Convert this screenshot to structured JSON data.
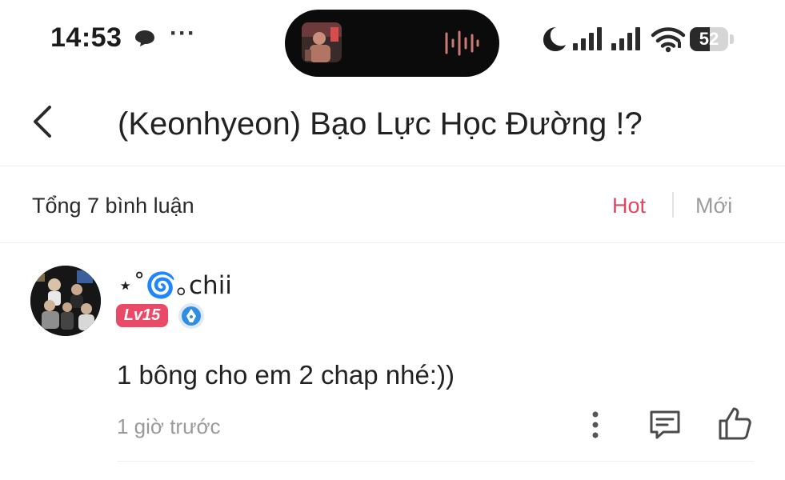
{
  "status_bar": {
    "time": "14:53",
    "battery": "52",
    "battery_level": 0.52,
    "icons": [
      "chat-bubble-icon",
      "more-dots-icon",
      "moon-icon",
      "signal-icon",
      "signal-icon",
      "wifi-icon",
      "battery-icon"
    ]
  },
  "dynamic_island": {
    "icons": [
      "media-thumbnail",
      "audio-wave-icon"
    ],
    "wave_color": "#c97a75"
  },
  "header": {
    "back_icon": "chevron-left-icon",
    "title": "(Keonhyeon) Bạo Lực Học Đường !?"
  },
  "sort_bar": {
    "count_label": "Tổng 7 bình luận",
    "tabs": [
      {
        "label": "Hot",
        "active": true
      },
      {
        "label": "Mới",
        "active": false
      }
    ],
    "active_color": "#e0465f"
  },
  "comments": [
    {
      "username": "⋆˚🌀｡chii",
      "level": "Lv15",
      "level_color": "#ea4a67",
      "badge_icon": "verified-pen-icon",
      "text": "1 bông cho em 2 chap nhé:))",
      "time": "1 giờ trước",
      "actions": [
        "more-vertical-icon",
        "reply-icon",
        "like-icon"
      ]
    }
  ]
}
